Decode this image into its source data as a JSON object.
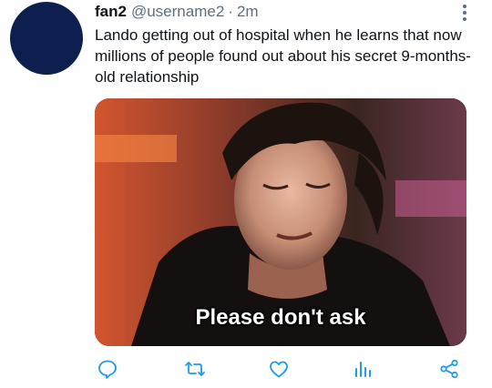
{
  "tweet": {
    "author_name": "fan2",
    "author_handle": "@username2",
    "separator": "·",
    "time": "2m",
    "text": "Lando getting out of hospital when he learns that now millions of people found out about his secret 9-months-old relationship",
    "media_caption": "Please don't ask"
  },
  "icons": {
    "more": "more-vertical-icon",
    "reply": "reply-icon",
    "retweet": "retweet-icon",
    "like": "heart-icon",
    "analytics": "analytics-icon",
    "share": "share-icon"
  },
  "colors": {
    "avatar": "#0d1f4e",
    "secondary_text": "#5b7083",
    "icon": "#1d9bf0"
  }
}
